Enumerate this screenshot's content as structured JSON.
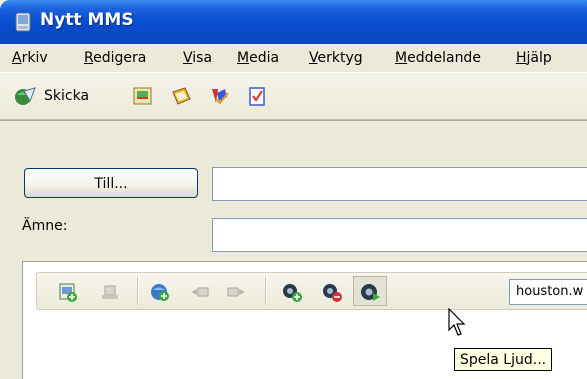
{
  "window": {
    "title": "Nytt MMS",
    "title_icon": "mms-envelope-icon"
  },
  "menu": {
    "items": [
      "Arkiv",
      "Redigera",
      "Visa",
      "Media",
      "Verktyg",
      "Meddelande",
      "Hjälp"
    ]
  },
  "toolbar": {
    "send_label": "Skicka",
    "icons": [
      "send-icon",
      "image-icon",
      "address-book-icon",
      "spellcheck-icon",
      "check-names-icon"
    ]
  },
  "header": {
    "to_button_label": "Till...",
    "to_value": "",
    "subject_label": "Ämne:",
    "subject_value": ""
  },
  "media_toolbar": {
    "icons": [
      "add-image-icon",
      "remove-image-icon",
      "add-slide-icon",
      "prev-slide-icon",
      "next-slide-icon",
      "add-sound-icon",
      "remove-sound-icon",
      "play-sound-icon"
    ],
    "sound_file": "houston.w"
  },
  "tooltip": {
    "text": "Spela Ljud..."
  },
  "colors": {
    "titlebar": "#0b4fd3",
    "chrome": "#ece9d8",
    "field_border": "#7f9db9",
    "tooltip_bg": "#ffffe1"
  }
}
